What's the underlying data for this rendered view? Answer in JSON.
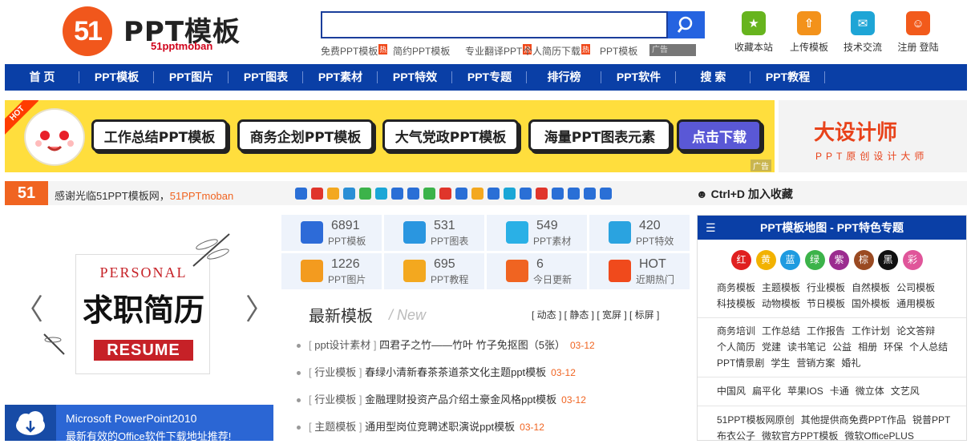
{
  "header": {
    "logo_mark": "51",
    "logo_title": "PPT模板",
    "logo_sub": "51pptmoban",
    "search_value": "",
    "hot_links": [
      {
        "label": "免费PPT模板",
        "hot": true
      },
      {
        "label": "简约PPT模板",
        "hot": false
      },
      {
        "label": "专业翻译PPT",
        "hot": true
      },
      {
        "label": "个人简历下载",
        "hot": true
      },
      {
        "label": "PPT模板",
        "hot": false
      }
    ],
    "hot_mark": "热",
    "ad_label": "广告",
    "tools": [
      {
        "label": "收藏本站",
        "icon": "star-icon",
        "color": "#67b41e"
      },
      {
        "label": "上传模板",
        "icon": "upload-icon",
        "color": "#f3921b"
      },
      {
        "label": "技术交流",
        "icon": "chat-icon",
        "color": "#1ea5d6"
      },
      {
        "label": "注册 登陆",
        "icon": "user-icon",
        "color": "#f25a1b"
      }
    ]
  },
  "nav": [
    "首 页",
    "PPT模板",
    "PPT图片",
    "PPT图表",
    "PPT素材",
    "PPT特效",
    "PPT专题",
    "排行榜",
    "PPT软件",
    "搜 索",
    "PPT教程"
  ],
  "banner": {
    "hot": "HOT",
    "pills": [
      "工作总结PPT模板",
      "商务企划PPT模板",
      "大气党政PPT模板",
      "海量PPT图表元素",
      "点击下载"
    ],
    "ad": "广告"
  },
  "banner2": {
    "logo": "大设计师",
    "sub": "PPT原创设计大师"
  },
  "sharebar": {
    "logo": "51",
    "text_prefix": "感谢光临51PPT模板网，",
    "text_site": "51PPTmoban",
    "ctrl": "Ctrl+D 加入收藏"
  },
  "slider": {
    "personal": "PERSONAL",
    "calligraphy": "求职简历",
    "resume": "RESUME",
    "prev": "〈",
    "next": "〉"
  },
  "office": {
    "title": "Microsoft PowerPoint2010",
    "subtitle": "最新有效的Office软件下载地址推荐!"
  },
  "stats": [
    {
      "num": "6891",
      "label": "PPT模板",
      "icon": "ppt-icon",
      "color": "#2d6bd8"
    },
    {
      "num": "531",
      "label": "PPT图表",
      "icon": "pie-chart-icon",
      "color": "#2a96e0"
    },
    {
      "num": "549",
      "label": "PPT素材",
      "icon": "material-icon",
      "color": "#2ab0e6"
    },
    {
      "num": "420",
      "label": "PPT特效",
      "icon": "loading-icon",
      "color": "#2aa3e0"
    },
    {
      "num": "1226",
      "label": "PPT图片",
      "icon": "image-icon",
      "color": "#f39b1f"
    },
    {
      "num": "695",
      "label": "PPT教程",
      "icon": "book-icon",
      "color": "#f3a81f"
    },
    {
      "num": "6",
      "label": "今日更新",
      "icon": "refresh-icon",
      "color": "#f06421"
    },
    {
      "num": "HOT",
      "label": "近期热门",
      "icon": "hot-icon",
      "color": "#f04a1c"
    }
  ],
  "latest": {
    "title": "最新模板",
    "title_en": "/ New",
    "tabs": "[ 动态 ] [ 静态 ] [ 宽屏 ] [ 标屏 ]",
    "items": [
      {
        "cat": "ppt设计素材",
        "title": "四君子之竹——竹叶 竹子免抠图（5张）",
        "date": "03-12"
      },
      {
        "cat": "行业模板",
        "title": "春绿小清新春茶茶道茶文化主题ppt模板",
        "date": "03-12"
      },
      {
        "cat": "行业模板",
        "title": "金融理财投资产品介绍土豪金风格ppt模板",
        "date": "03-12"
      },
      {
        "cat": "主题模板",
        "title": "通用型岗位竞聘述职演说ppt模板",
        "date": "03-12"
      }
    ]
  },
  "map": {
    "title": "PPT模板地图 - PPT特色专题",
    "colors": [
      {
        "label": "红",
        "color": "#e02020"
      },
      {
        "label": "黄",
        "color": "#f2b200"
      },
      {
        "label": "蓝",
        "color": "#1f9be0"
      },
      {
        "label": "绿",
        "color": "#3cb34a"
      },
      {
        "label": "紫",
        "color": "#9b2c8f"
      },
      {
        "label": "棕",
        "color": "#9a4a22"
      },
      {
        "label": "黑",
        "color": "#111111"
      },
      {
        "label": "彩",
        "color": "#e0559a"
      }
    ],
    "group1": [
      "商务模板",
      "主题模板",
      "行业模板",
      "自然模板",
      "公司模板",
      "科技模板",
      "动物模板",
      "节日模板",
      "国外模板",
      "通用模板"
    ],
    "group2": [
      "商务培训",
      "工作总结",
      "工作报告",
      "工作计划",
      "论文答辩",
      "个人简历",
      "党建",
      "读书笔记",
      "公益",
      "相册",
      "环保",
      "个人总结",
      "PPT情景剧",
      "学生",
      "营销方案",
      "婚礼"
    ],
    "group3": [
      "中国风",
      "扁平化",
      "苹果IOS",
      "卡通",
      "微立体",
      "文艺风"
    ],
    "group4": [
      "51PPT模板网原创",
      "其他提供商免费PPT作品",
      "锐普PPT",
      "布衣公子",
      "微软官方PPT模板",
      "微软OfficePLUS"
    ]
  }
}
